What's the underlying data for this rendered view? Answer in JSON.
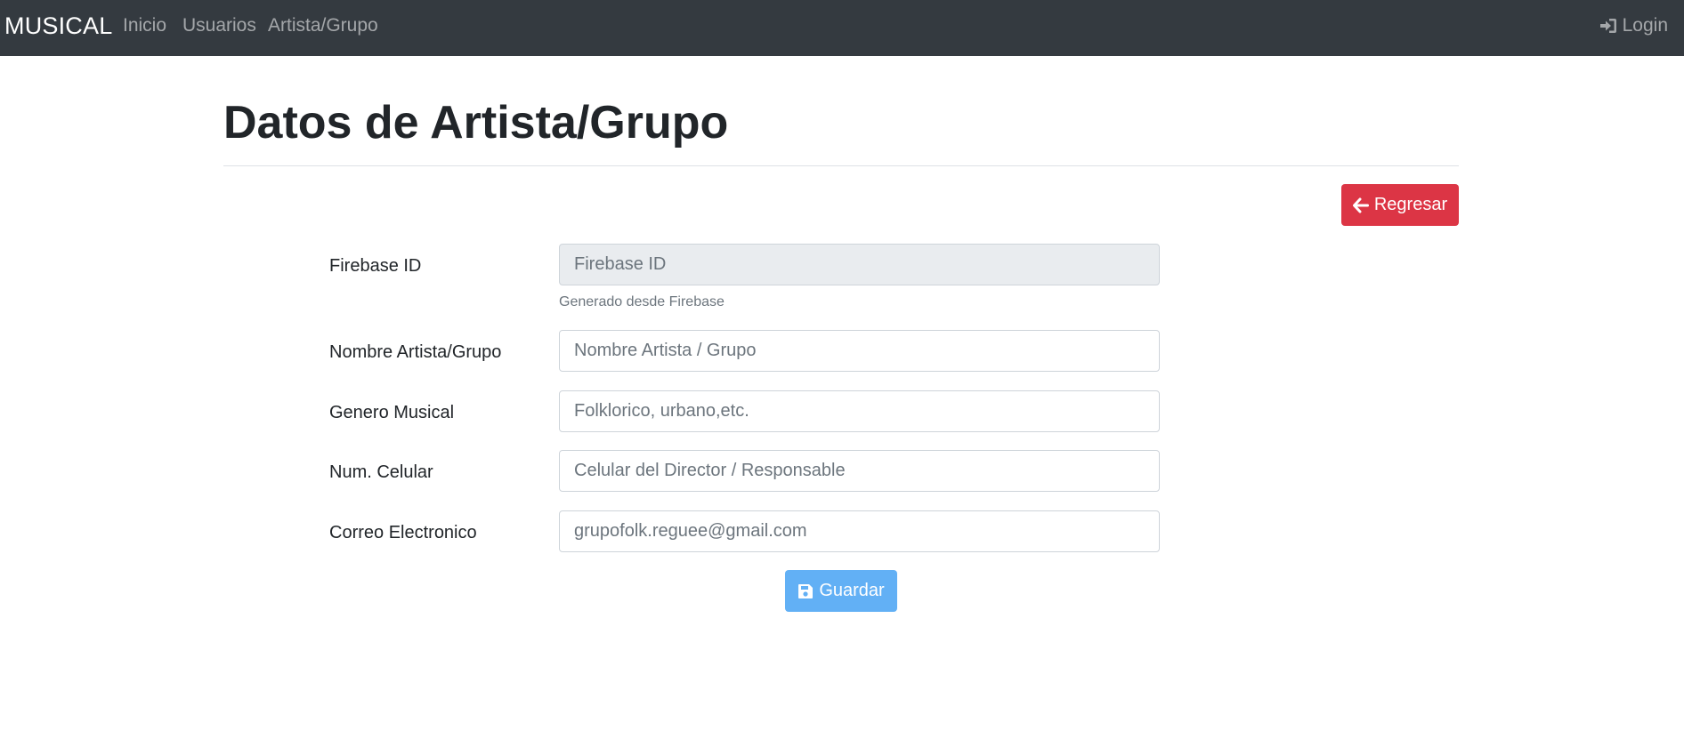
{
  "navbar": {
    "brand": "MUSICAL",
    "links": [
      "Inicio",
      "Usuarios",
      "Artista/Grupo"
    ],
    "login_label": "Login",
    "login_icon": "sign-in-icon",
    "background": "#343a40"
  },
  "page": {
    "title": "Datos de Artista/Grupo"
  },
  "actions": {
    "back_label": "Regresar",
    "back_icon": "arrow-left-icon",
    "back_color": "#dc3545",
    "save_label": "Guardar",
    "save_icon": "floppy-disk-icon",
    "save_color": "#62b0f5"
  },
  "form": {
    "fields": [
      {
        "label": "Firebase ID",
        "placeholder": "Firebase ID",
        "value": "",
        "disabled": true,
        "help": "Generado desde Firebase"
      },
      {
        "label": "Nombre Artista/Grupo",
        "placeholder": "Nombre Artista / Grupo",
        "value": ""
      },
      {
        "label": "Genero Musical",
        "placeholder": "Folklorico, urbano,etc.",
        "value": ""
      },
      {
        "label": "Num. Celular",
        "placeholder": "Celular del Director / Responsable",
        "value": ""
      },
      {
        "label": "Correo Electronico",
        "placeholder": "grupofolk.reguee@gmail.com",
        "value": ""
      }
    ]
  }
}
